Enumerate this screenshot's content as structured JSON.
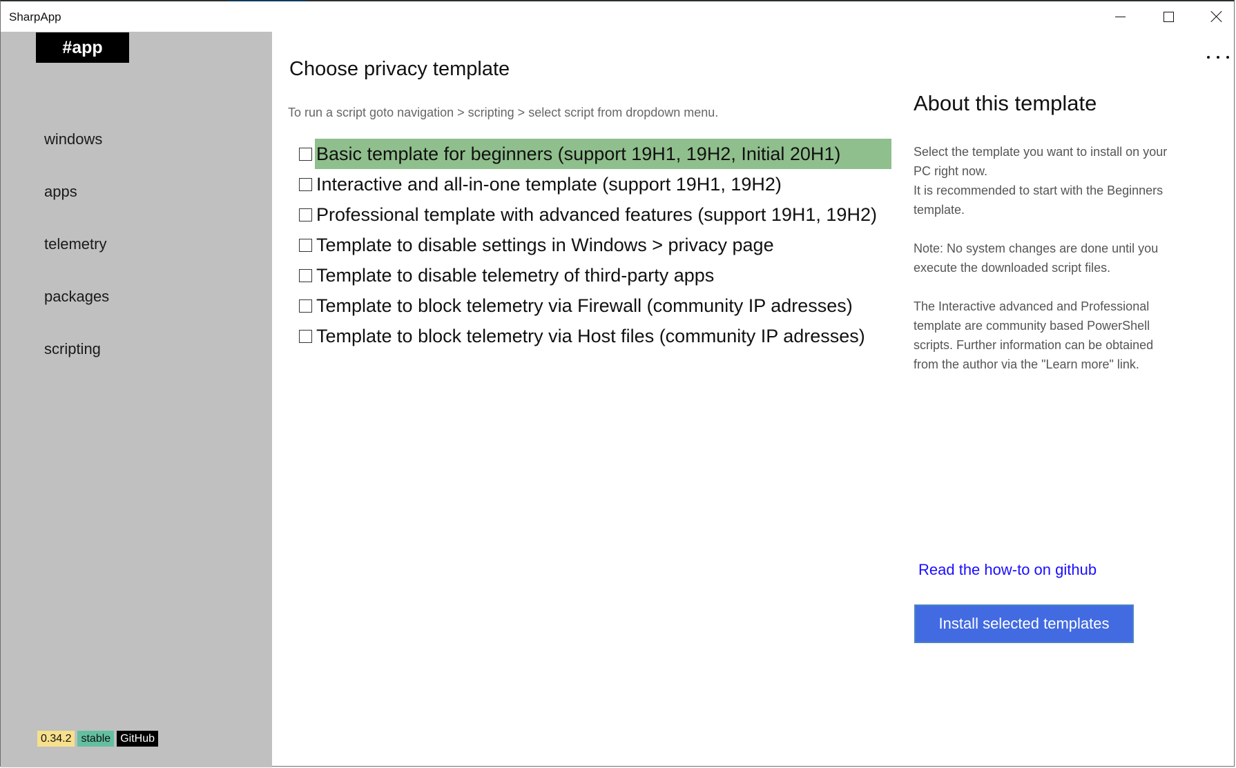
{
  "window": {
    "title": "SharpApp",
    "controls": {
      "minimize": "minimize",
      "maximize": "maximize",
      "close": "close"
    }
  },
  "sidebar": {
    "logo": "#app",
    "items": [
      {
        "label": "windows"
      },
      {
        "label": "apps"
      },
      {
        "label": "telemetry"
      },
      {
        "label": "packages"
      },
      {
        "label": "scripting"
      }
    ],
    "badges": {
      "version": "0.34.2",
      "channel": "stable",
      "github": "GitHub"
    }
  },
  "main": {
    "title": "Choose privacy template",
    "hint": "To run a script goto navigation > scripting > select script from dropdown menu.",
    "templates": [
      {
        "label": "Basic template for beginners (support 19H1, 19H2, Initial 20H1)",
        "checked": false,
        "highlighted": true
      },
      {
        "label": "Interactive and all-in-one template (support 19H1, 19H2)",
        "checked": false,
        "highlighted": false
      },
      {
        "label": "Professional template with advanced features (support 19H1, 19H2)",
        "checked": false,
        "highlighted": false
      },
      {
        "label": "Template to disable settings in Windows > privacy page",
        "checked": false,
        "highlighted": false
      },
      {
        "label": "Template to disable telemetry of third-party apps",
        "checked": false,
        "highlighted": false
      },
      {
        "label": "Template to block telemetry via Firewall (community IP adresses)",
        "checked": false,
        "highlighted": false
      },
      {
        "label": "Template to block telemetry via Host files (community IP adresses)",
        "checked": false,
        "highlighted": false
      }
    ]
  },
  "about": {
    "title": "About this template",
    "paragraphs": [
      "Select the template you want to install on your\nPC right now.\nIt is recommended to start with the Beginners\ntemplate.",
      "Note: No system changes are done until you\nexecute the downloaded script files.",
      "The Interactive advanced and Professional\ntemplate are community based PowerShell\nscripts. Further information can be obtained\nfrom the author via the \"Learn more\" link."
    ],
    "link": "Read the how-to on github",
    "install_button": "Install selected templates"
  },
  "more_menu": {
    "icon": "more-horizontal-icon"
  },
  "colors": {
    "sidebar_bg": "#c0c0c0",
    "highlight": "#8fbf8c",
    "accent_button": "#426be2",
    "link": "#1a0dff",
    "badge_version": "#f7e08c",
    "badge_channel": "#63bfa0",
    "badge_github": "#000000"
  }
}
